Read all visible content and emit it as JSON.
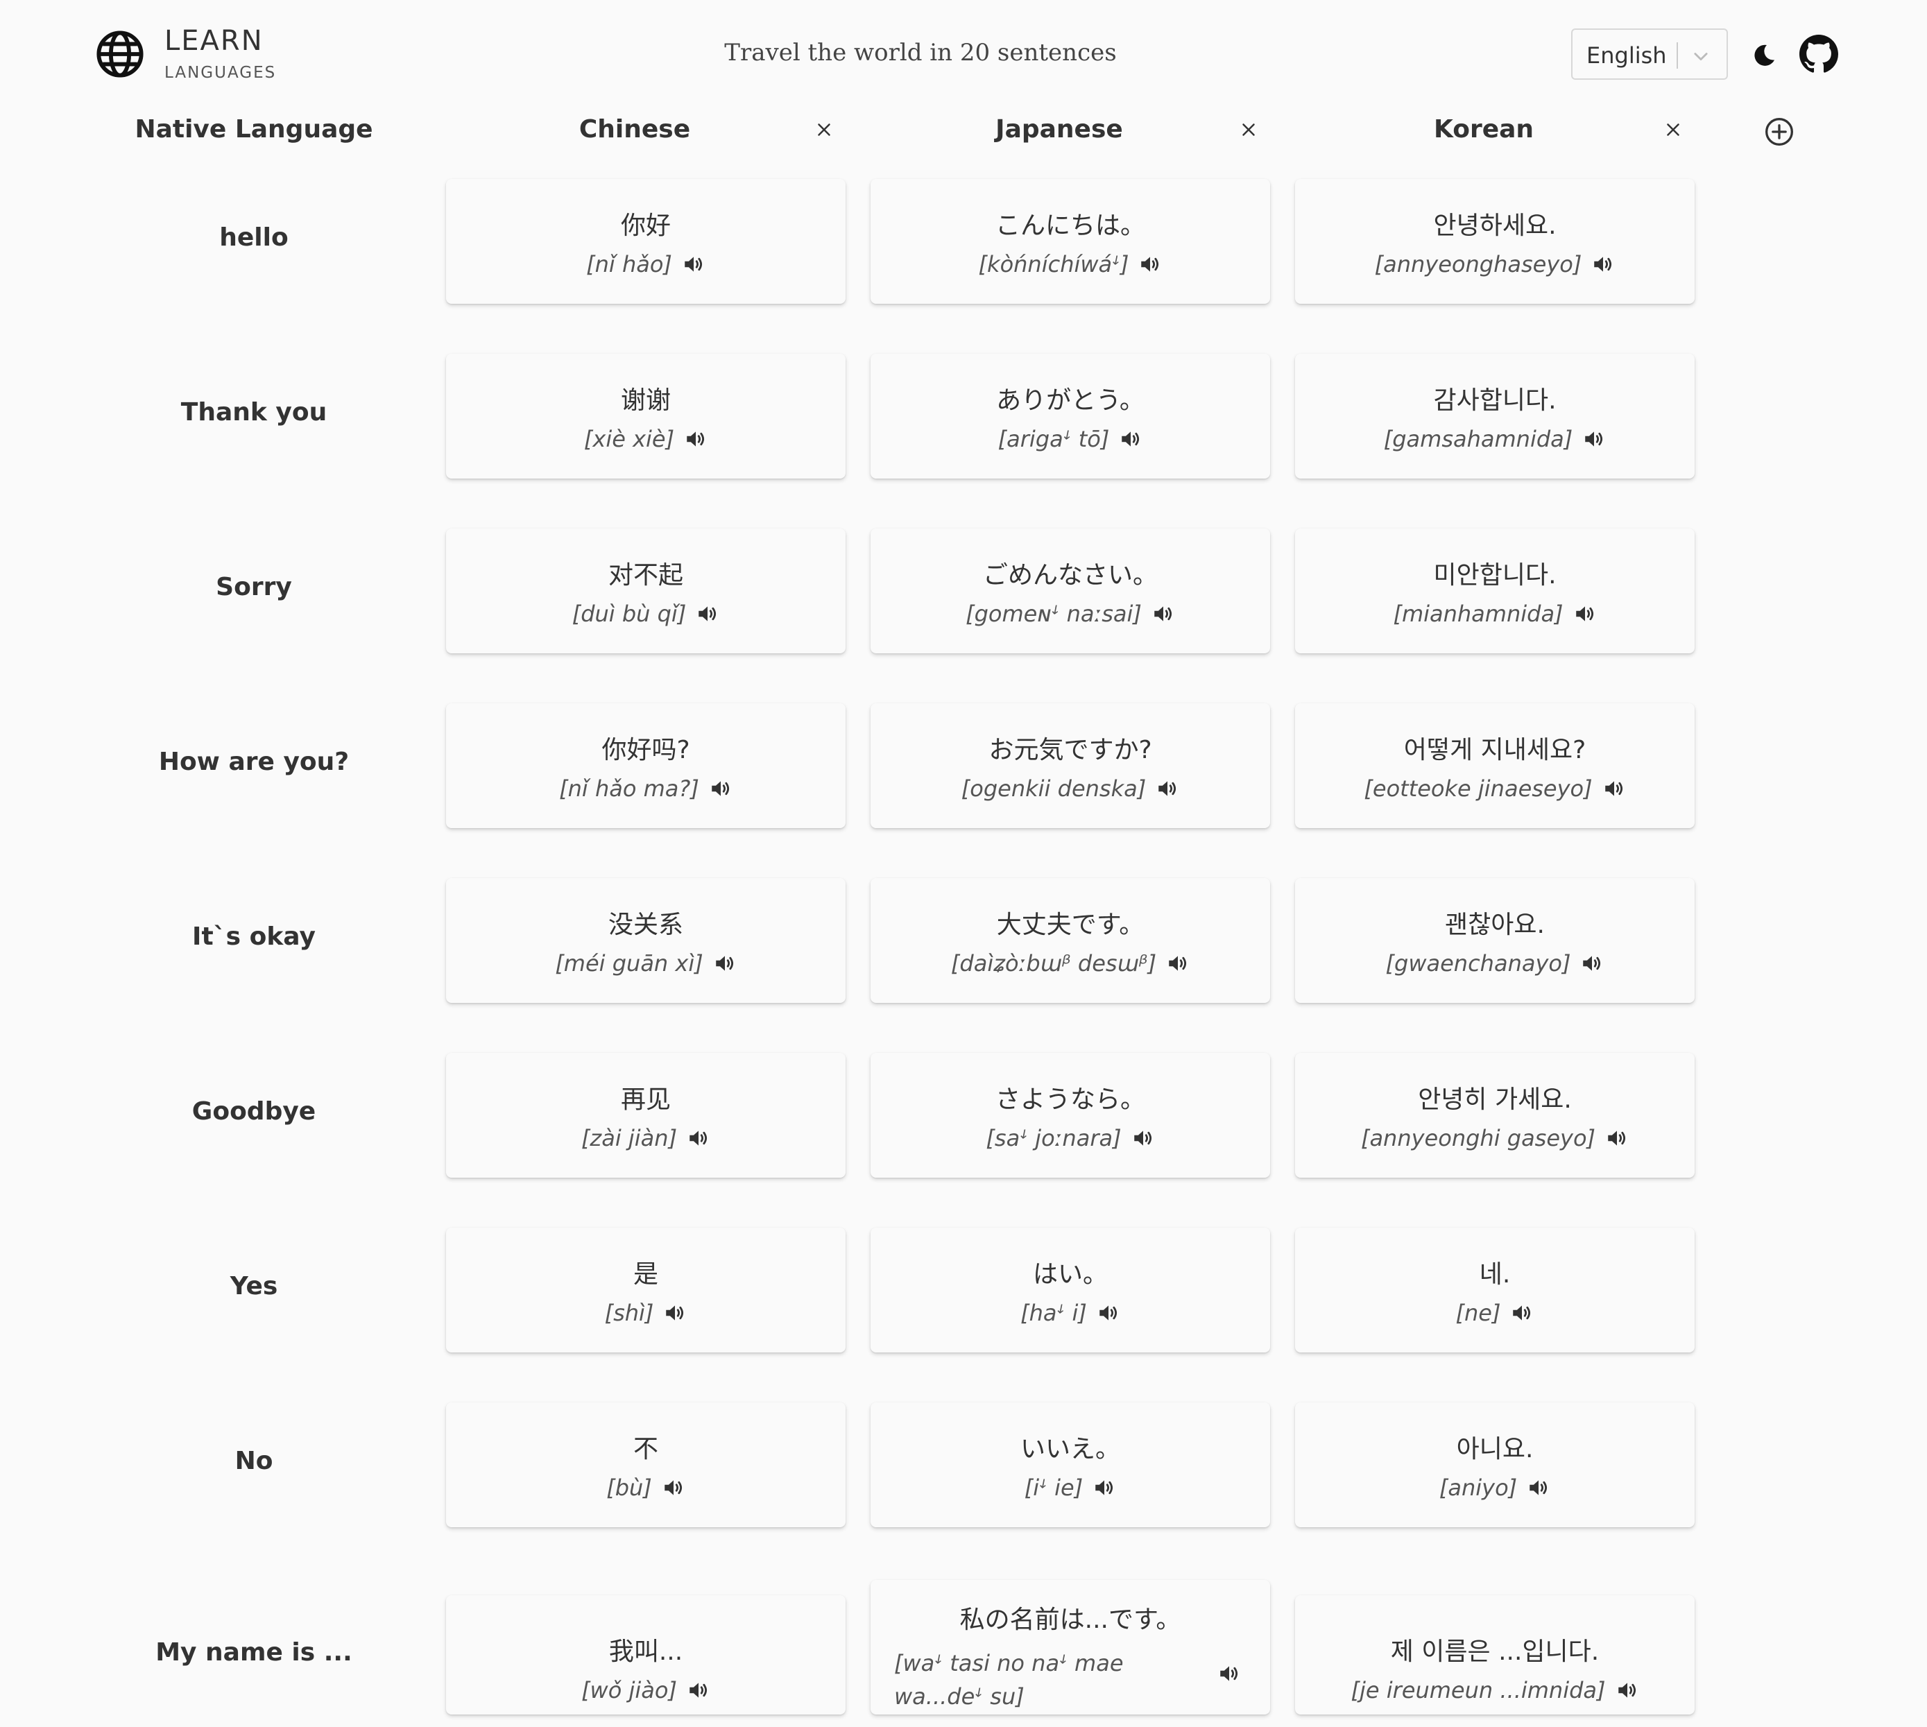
{
  "header": {
    "brand_title": "LEARN",
    "brand_sub": "LANGUAGES",
    "tagline": "Travel the world in 20 sentences",
    "language_select": "English",
    "icons": [
      "globe-icon",
      "chevron-down-icon",
      "moon-icon",
      "github-icon"
    ]
  },
  "columns": {
    "native": "Native Language",
    "languages": [
      "Chinese",
      "Japanese",
      "Korean"
    ]
  },
  "rows": [
    {
      "label": "hello",
      "zh": {
        "text": "你好",
        "roman": "[nǐ hǎo]"
      },
      "ja": {
        "text": "こんにちは。",
        "roman": "[kòńníchíwáꜜ]"
      },
      "ko": {
        "text": "안녕하세요.",
        "roman": "[annyeonghaseyo]"
      }
    },
    {
      "label": "Thank you",
      "zh": {
        "text": "谢谢",
        "roman": "[xiè xiè]"
      },
      "ja": {
        "text": "ありがとう。",
        "roman": "[arigaꜜ tō]"
      },
      "ko": {
        "text": "감사합니다.",
        "roman": "[gamsahamnida]"
      }
    },
    {
      "label": "Sorry",
      "zh": {
        "text": "对不起",
        "roman": "[duì bù qǐ]"
      },
      "ja": {
        "text": "ごめんなさい。",
        "roman": "[gomeɴꜜ naːsai]"
      },
      "ko": {
        "text": "미안합니다.",
        "roman": "[mianhamnida]"
      }
    },
    {
      "label": "How are you?",
      "zh": {
        "text": "你好吗?",
        "roman": "[nǐ hǎo ma?]"
      },
      "ja": {
        "text": "お元気ですか?",
        "roman": "[ogenkii denska]"
      },
      "ko": {
        "text": "어떻게 지내세요?",
        "roman": "[eotteoke jinaeseyo]"
      }
    },
    {
      "label": "It`s okay",
      "zh": {
        "text": "没关系",
        "roman": "[méi guān xì]"
      },
      "ja": {
        "text": "大丈夫です。",
        "roman": "[daìʑòːbɯᵝ desɯᵝ]"
      },
      "ko": {
        "text": "괜찮아요.",
        "roman": "[gwaenchanayo]"
      }
    },
    {
      "label": "Goodbye",
      "zh": {
        "text": "再见",
        "roman": "[zài jiàn]"
      },
      "ja": {
        "text": "さようなら。",
        "roman": "[saꜜ joːnara]"
      },
      "ko": {
        "text": "안녕히 가세요.",
        "roman": "[annyeonghi gaseyo]"
      }
    },
    {
      "label": "Yes",
      "zh": {
        "text": "是",
        "roman": "[shì]"
      },
      "ja": {
        "text": "はい。",
        "roman": "[haꜜ i]"
      },
      "ko": {
        "text": "네.",
        "roman": "[ne]"
      }
    },
    {
      "label": "No",
      "zh": {
        "text": "不",
        "roman": "[bù]"
      },
      "ja": {
        "text": "いいえ。",
        "roman": "[iꜜ ie]"
      },
      "ko": {
        "text": "아니요.",
        "roman": "[aniyo]"
      }
    },
    {
      "label": "My name is ...",
      "zh": {
        "text": "我叫...",
        "roman": "[wǒ jiào]"
      },
      "ja": {
        "text": "私の名前は...です。",
        "roman_line1": "[waꜜ tasi no naꜜ mae",
        "roman_line2": "wa...deꜜ su]"
      },
      "ko": {
        "text": "제 이름은 ...입니다.",
        "roman": "[je ireumeun ...imnida]"
      }
    }
  ]
}
